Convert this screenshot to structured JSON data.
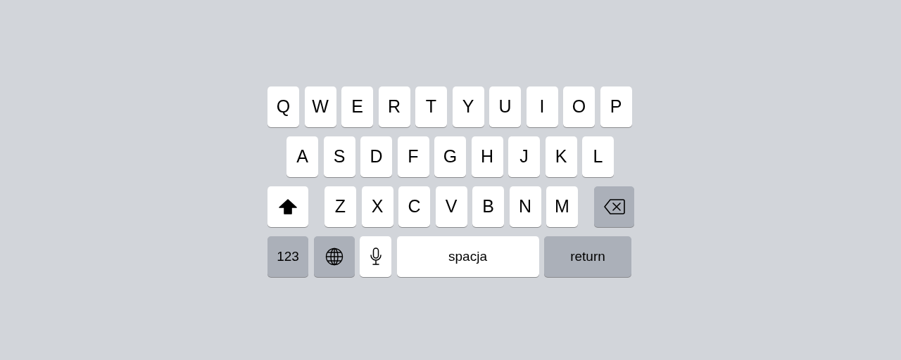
{
  "keyboard": {
    "rows": [
      {
        "keys": [
          {
            "kind": "letter",
            "label": "Q"
          },
          {
            "kind": "letter",
            "label": "W"
          },
          {
            "kind": "letter",
            "label": "E"
          },
          {
            "kind": "letter",
            "label": "R"
          },
          {
            "kind": "letter",
            "label": "T"
          },
          {
            "kind": "letter",
            "label": "Y"
          },
          {
            "kind": "letter",
            "label": "U"
          },
          {
            "kind": "letter",
            "label": "I"
          },
          {
            "kind": "letter",
            "label": "O"
          },
          {
            "kind": "letter",
            "label": "P"
          }
        ]
      },
      {
        "keys": [
          {
            "kind": "letter",
            "label": "A"
          },
          {
            "kind": "letter",
            "label": "S"
          },
          {
            "kind": "letter",
            "label": "D"
          },
          {
            "kind": "letter",
            "label": "F"
          },
          {
            "kind": "letter",
            "label": "G"
          },
          {
            "kind": "letter",
            "label": "H"
          },
          {
            "kind": "letter",
            "label": "J"
          },
          {
            "kind": "letter",
            "label": "K"
          },
          {
            "kind": "letter",
            "label": "L"
          }
        ]
      },
      {
        "keys": [
          {
            "kind": "shift",
            "on": true
          },
          {
            "kind": "letter",
            "label": "Z"
          },
          {
            "kind": "letter",
            "label": "X"
          },
          {
            "kind": "letter",
            "label": "C"
          },
          {
            "kind": "letter",
            "label": "V"
          },
          {
            "kind": "letter",
            "label": "B"
          },
          {
            "kind": "letter",
            "label": "N"
          },
          {
            "kind": "letter",
            "label": "M"
          },
          {
            "kind": "delete"
          }
        ]
      },
      {
        "keys": [
          {
            "kind": "numbers",
            "label": "123"
          },
          {
            "kind": "globe"
          },
          {
            "kind": "mic"
          },
          {
            "kind": "space",
            "label": "spacja"
          },
          {
            "kind": "return",
            "label": "return"
          }
        ]
      }
    ]
  }
}
